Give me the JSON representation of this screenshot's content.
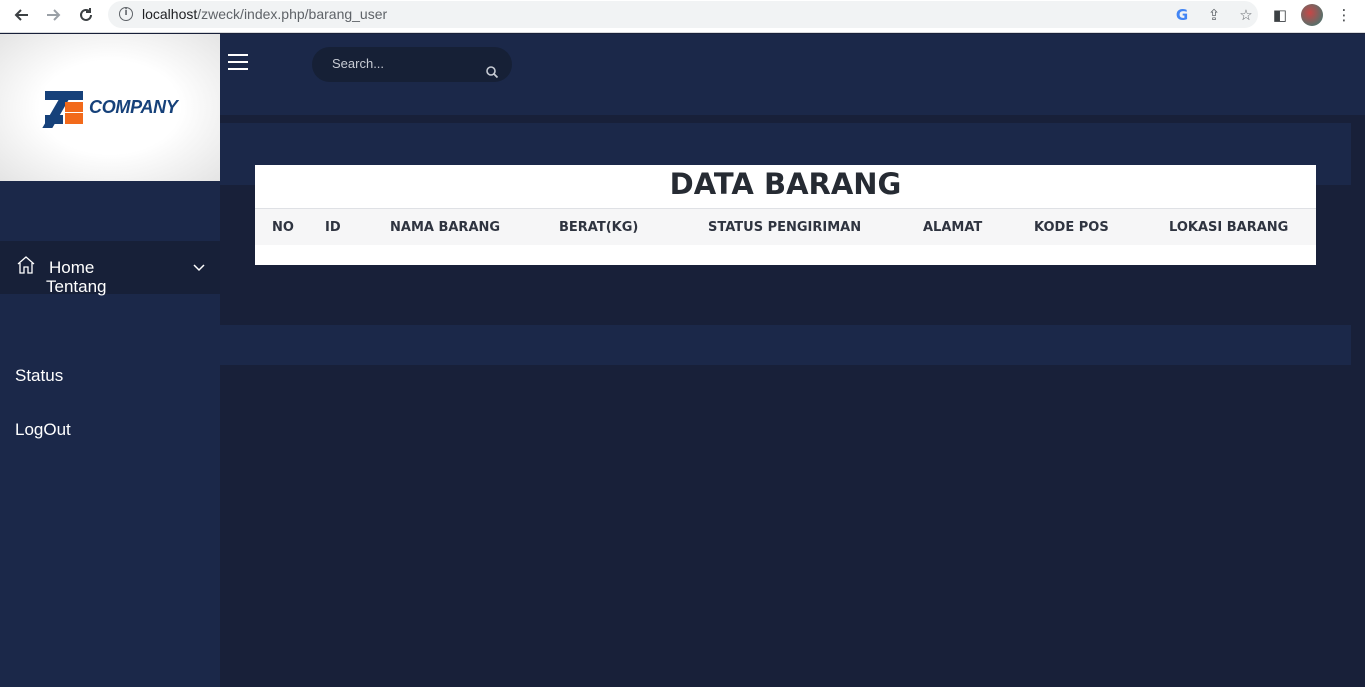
{
  "browser": {
    "url_host": "localhost",
    "url_path": "/zweck/index.php/barang_user",
    "back_icon": "arrow-left-icon",
    "forward_icon": "arrow-right-icon",
    "reload_icon": "reload-icon"
  },
  "sidebar": {
    "logo_text": "COMPANY",
    "home": {
      "label": "Home",
      "icon": "home-icon"
    },
    "submenu": [
      {
        "label": "Tentang"
      }
    ],
    "items": [
      {
        "label": "Status"
      },
      {
        "label": "LogOut"
      }
    ]
  },
  "topbar": {
    "search_placeholder": "Search..."
  },
  "card": {
    "title": "DATA BARANG",
    "columns": [
      "NO",
      "ID",
      "NAMA BARANG",
      "BERAT(KG)",
      "STATUS PENGIRIMAN",
      "ALAMAT",
      "KODE POS",
      "LOKASI BARANG"
    ]
  },
  "colors": {
    "sidebar_bg": "#1b2849",
    "page_bg": "#182039",
    "brand_blue": "#16417a",
    "brand_orange": "#f26a1b"
  }
}
